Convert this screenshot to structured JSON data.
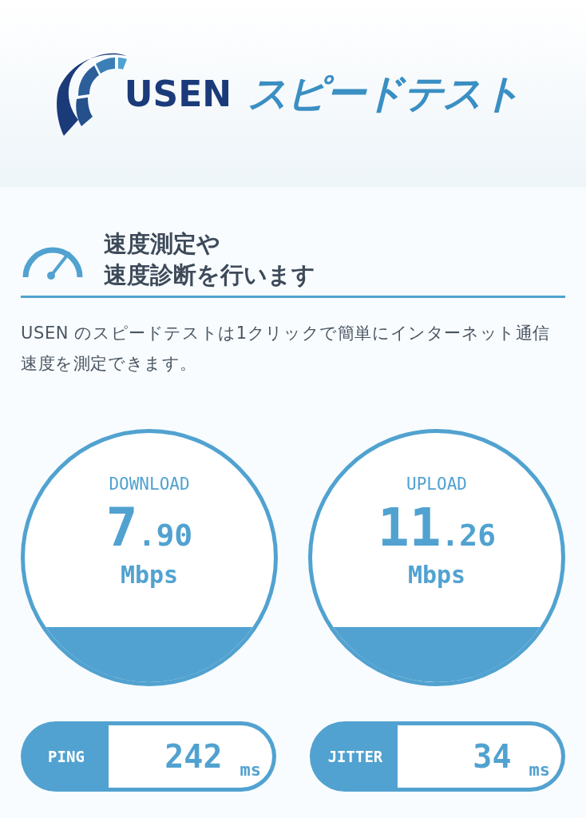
{
  "logo": {
    "brand": "USEN",
    "product": "スピードテスト"
  },
  "intro": {
    "title_lines": [
      "速度測定や",
      "速度診断を行います"
    ],
    "description": "USEN のスピードテストは1クリックで簡単にインターネット通信速度を測定できます。"
  },
  "gauges": [
    {
      "label": "DOWNLOAD",
      "integer": "7",
      "decimal": ".90",
      "unit": "Mbps"
    },
    {
      "label": "UPLOAD",
      "integer": "11",
      "decimal": ".26",
      "unit": "Mbps"
    }
  ],
  "stats": [
    {
      "label": "PING",
      "value": "242",
      "unit": "ms"
    },
    {
      "label": "JITTER",
      "value": "34",
      "unit": "ms"
    }
  ]
}
